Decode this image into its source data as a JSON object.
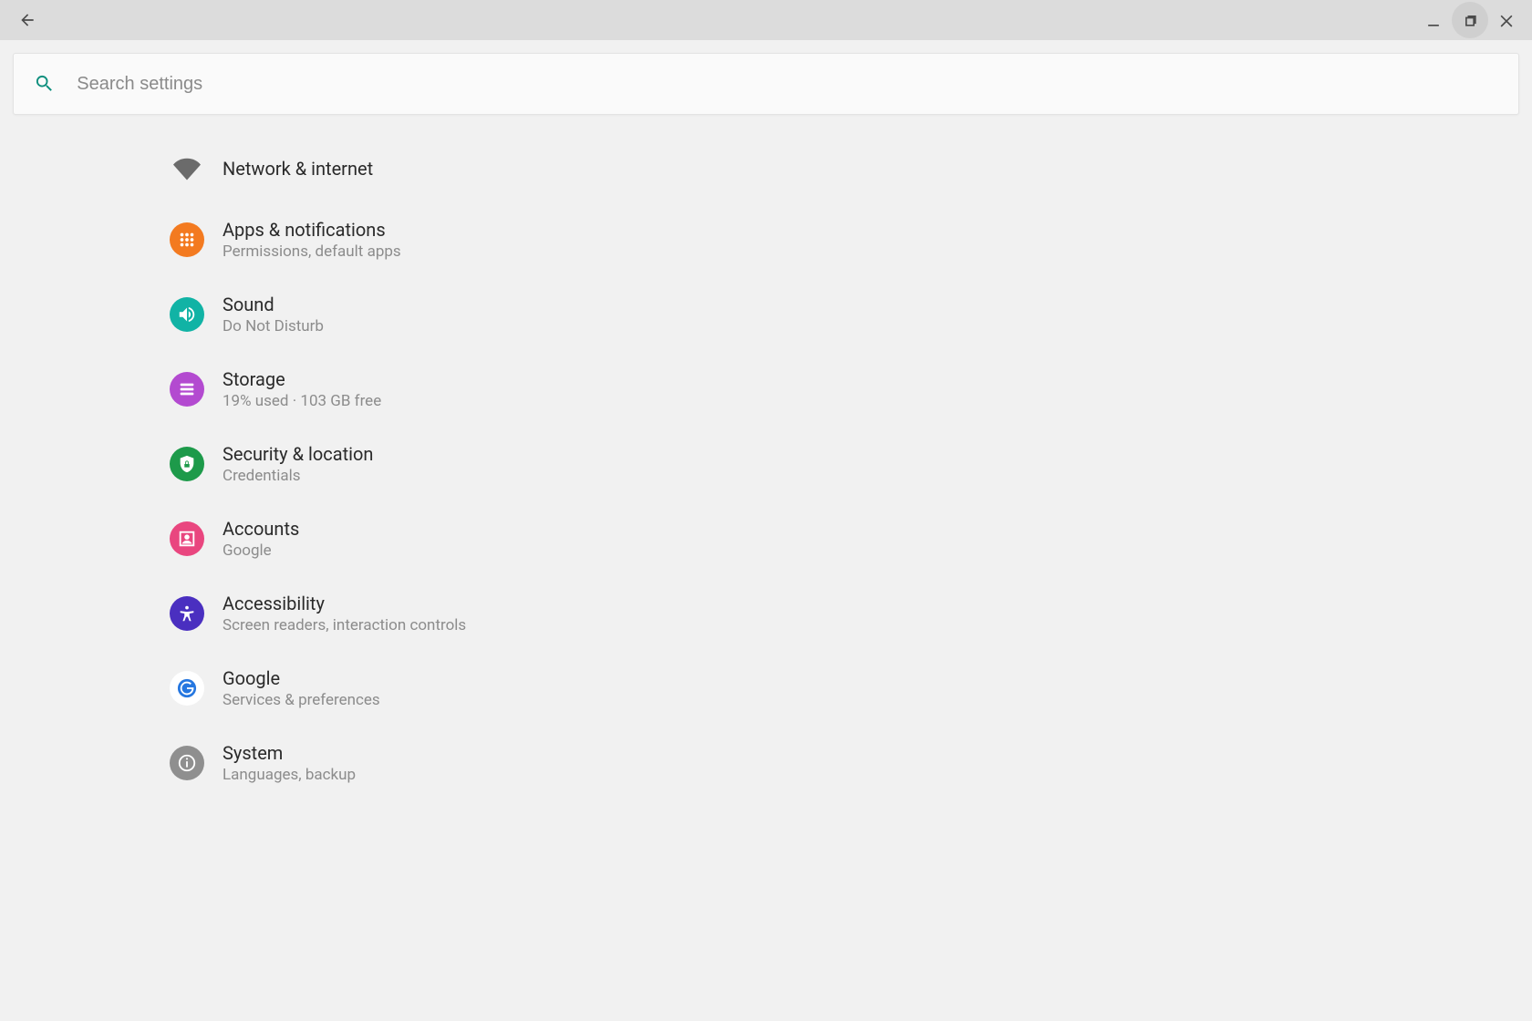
{
  "search": {
    "placeholder": "Search settings"
  },
  "items": [
    {
      "title": "Network & internet",
      "sub": ""
    },
    {
      "title": "Apps & notifications",
      "sub": "Permissions, default apps"
    },
    {
      "title": "Sound",
      "sub": "Do Not Disturb"
    },
    {
      "title": "Storage",
      "sub": "19% used · 103 GB free"
    },
    {
      "title": "Security & location",
      "sub": "Credentials"
    },
    {
      "title": "Accounts",
      "sub": "Google"
    },
    {
      "title": "Accessibility",
      "sub": "Screen readers, interaction controls"
    },
    {
      "title": "Google",
      "sub": "Services & preferences"
    },
    {
      "title": "System",
      "sub": "Languages, backup"
    }
  ],
  "colors": {
    "apps": "#f37a20",
    "sound": "#11b3a5",
    "storage": "#b34ad0",
    "security": "#1d9a4a",
    "accounts": "#e9467f",
    "accessibility": "#4a2fc0",
    "google": "#2677e0",
    "system": "#8f8f8f"
  }
}
